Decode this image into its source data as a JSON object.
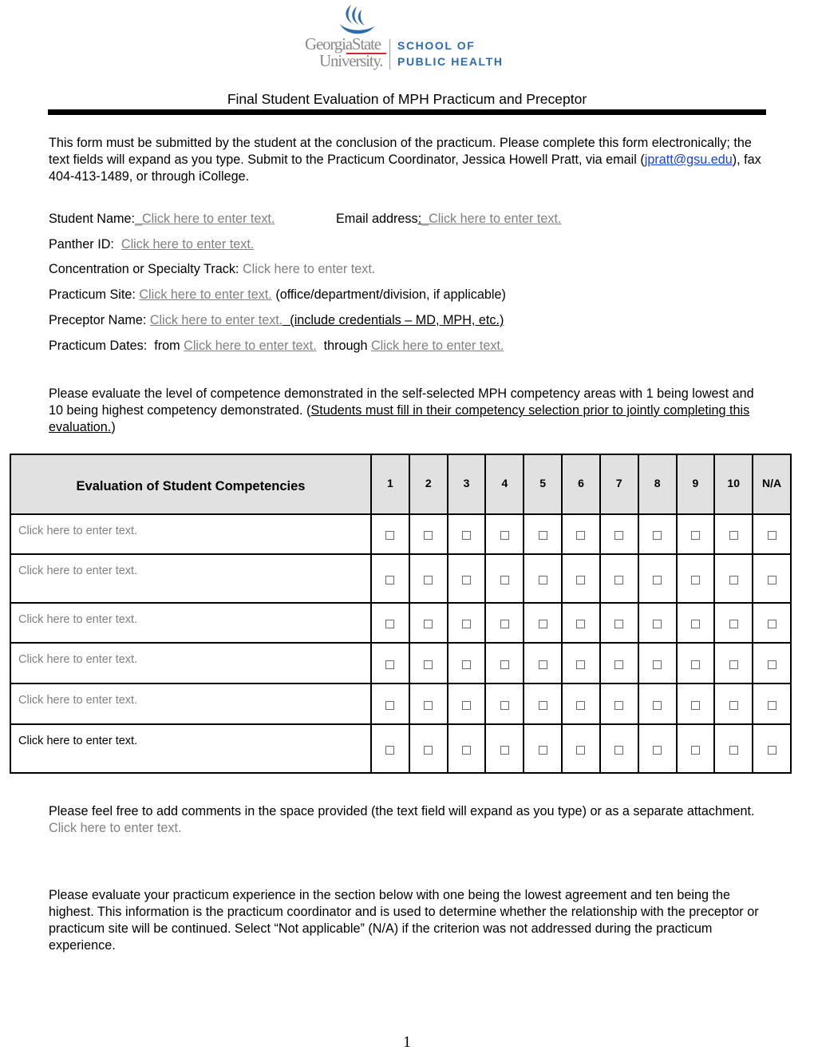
{
  "logo": {
    "university_line1": "GeorgiaState",
    "university_line2": "University.",
    "school_line1": "SCHOOL OF",
    "school_line2": "PUBLIC HEALTH",
    "icon": "flame-icon",
    "colors": {
      "blue": "#2a6bb3",
      "gray": "#8a8a8a",
      "red": "#d6262e"
    }
  },
  "title": "Final Student Evaluation of MPH Practicum and Preceptor",
  "intro": {
    "text_before_link": "This form must be submitted by the student at the conclusion of the practicum. Please complete this form electronically; the text fields will expand as you type. Submit to the Practicum Coordinator, Jessica Howell Pratt, via email (",
    "email_link": "jpratt@gsu.edu",
    "text_after_link": "), fax 404-413-1489, or through iCollege."
  },
  "placeholder": "Click here to enter text.",
  "fields": {
    "student_name": {
      "label": "Student Name:",
      "value": "_Click here to enter text."
    },
    "email": {
      "label": "Email address",
      "sep": ":",
      "value": "_Click here to enter text."
    },
    "panther_id": {
      "label": "Panther ID:",
      "value": "Click here to enter text."
    },
    "concentration": {
      "label": "Concentration or Specialty Track:",
      "value": "Click here to enter text."
    },
    "practicum_site": {
      "label": "Practicum Site:",
      "value": "Click here to enter text.",
      "note": "(office/department/division, if applicable)"
    },
    "preceptor_name": {
      "label": "Preceptor Name:",
      "value": "Click here to enter text.",
      "note": "  (include credentials – MD, MPH, etc.)"
    },
    "practicum_dates": {
      "label": "Practicum Dates:",
      "from_label": "from",
      "from_value": "Click here to enter text.",
      "through_label": "through",
      "through_value": "Click here to enter text."
    }
  },
  "competence_instructions": {
    "text": "Please evaluate the level of competence demonstrated in the self-selected MPH competency areas with 1 being lowest and 10 being highest competency demonstrated. (",
    "underlined": "Students must fill in their competency selection prior to jointly completing this evaluation.",
    "close": ")"
  },
  "table": {
    "header": "Evaluation of Student Competencies",
    "columns": [
      "1",
      "2",
      "3",
      "4",
      "5",
      "6",
      "7",
      "8",
      "9",
      "10",
      "N/A"
    ],
    "rows": [
      {
        "competency": "Click here to enter text.",
        "checked": [
          false,
          false,
          false,
          false,
          false,
          false,
          false,
          false,
          false,
          false,
          false
        ]
      },
      {
        "competency": "Click here to enter text.",
        "checked": [
          false,
          false,
          false,
          false,
          false,
          false,
          false,
          false,
          false,
          false,
          false
        ]
      },
      {
        "competency": "Click here to enter text.",
        "checked": [
          false,
          false,
          false,
          false,
          false,
          false,
          false,
          false,
          false,
          false,
          false
        ]
      },
      {
        "competency": "Click here to enter text.",
        "checked": [
          false,
          false,
          false,
          false,
          false,
          false,
          false,
          false,
          false,
          false,
          false
        ]
      },
      {
        "competency": "Click here to enter text.",
        "checked": [
          false,
          false,
          false,
          false,
          false,
          false,
          false,
          false,
          false,
          false,
          false
        ]
      },
      {
        "competency": "Click here to enter text.",
        "checked": [
          false,
          false,
          false,
          false,
          false,
          false,
          false,
          false,
          false,
          false,
          false
        ]
      }
    ],
    "checkbox_glyph": "☐"
  },
  "comments": {
    "text": "Please feel free to add comments in the space provided (the text field will expand as you type) or as a separate attachment.",
    "value": "Click here to enter text."
  },
  "practicum_instructions": "Please evaluate your practicum experience in the section below with one being the lowest agreement and ten being the highest. This information is the practicum coordinator and is used to determine whether the relationship with the preceptor or practicum site will be continued. Select “Not applicable” (N/A) if the criterion was not addressed during the practicum experience.",
  "page_number": "1"
}
